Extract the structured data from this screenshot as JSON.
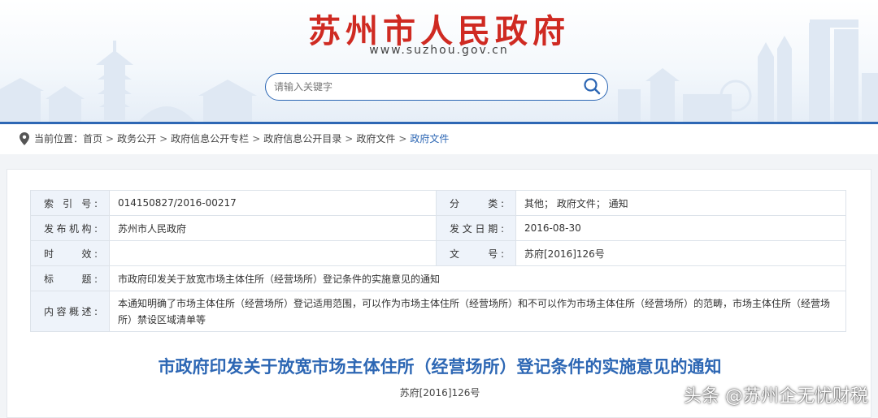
{
  "header": {
    "site_title": "苏州市人民政府",
    "site_url": "www.suzhou.gov.cn",
    "search_placeholder": "请输入关键字",
    "search_icon": "search-icon",
    "accent_color": "#cf2a22",
    "brand_blue": "#2d67b4"
  },
  "breadcrumb": {
    "label": "当前位置：",
    "icon": "location-pin-icon",
    "items": [
      "首页",
      "政务公开",
      "政府信息公开专栏",
      "政府信息公开目录",
      "政府文件",
      "政府文件"
    ],
    "separator": ">"
  },
  "meta": {
    "index_label": "索 引 号:",
    "index_value": "014150827/2016-00217",
    "category_label": "分　　类:",
    "category_value": "其他； 政府文件； 通知",
    "issuer_label": "发布机构:",
    "issuer_value": "苏州市人民政府",
    "date_label": "发文日期:",
    "date_value": "2016-08-30",
    "validity_label": "时　　效:",
    "validity_value": "",
    "docno_label": "文　　号:",
    "docno_value": "苏府[2016]126号",
    "title_label": "标　　题:",
    "title_value": "市政府印发关于放宽市场主体住所（经营场所）登记条件的实施意见的通知",
    "summary_label": "内容概述:",
    "summary_value": "本通知明确了市场主体住所（经营场所）登记适用范围，可以作为市场主体住所（经营场所）和不可以作为市场主体住所（经营场所）的范畴，市场主体住所（经营场所）禁设区域清单等"
  },
  "document": {
    "title": "市政府印发关于放宽市场主体住所（经营场所）登记条件的实施意见的通知",
    "number": "苏府[2016]126号"
  },
  "watermark": "头条 @苏州企无忧财税"
}
